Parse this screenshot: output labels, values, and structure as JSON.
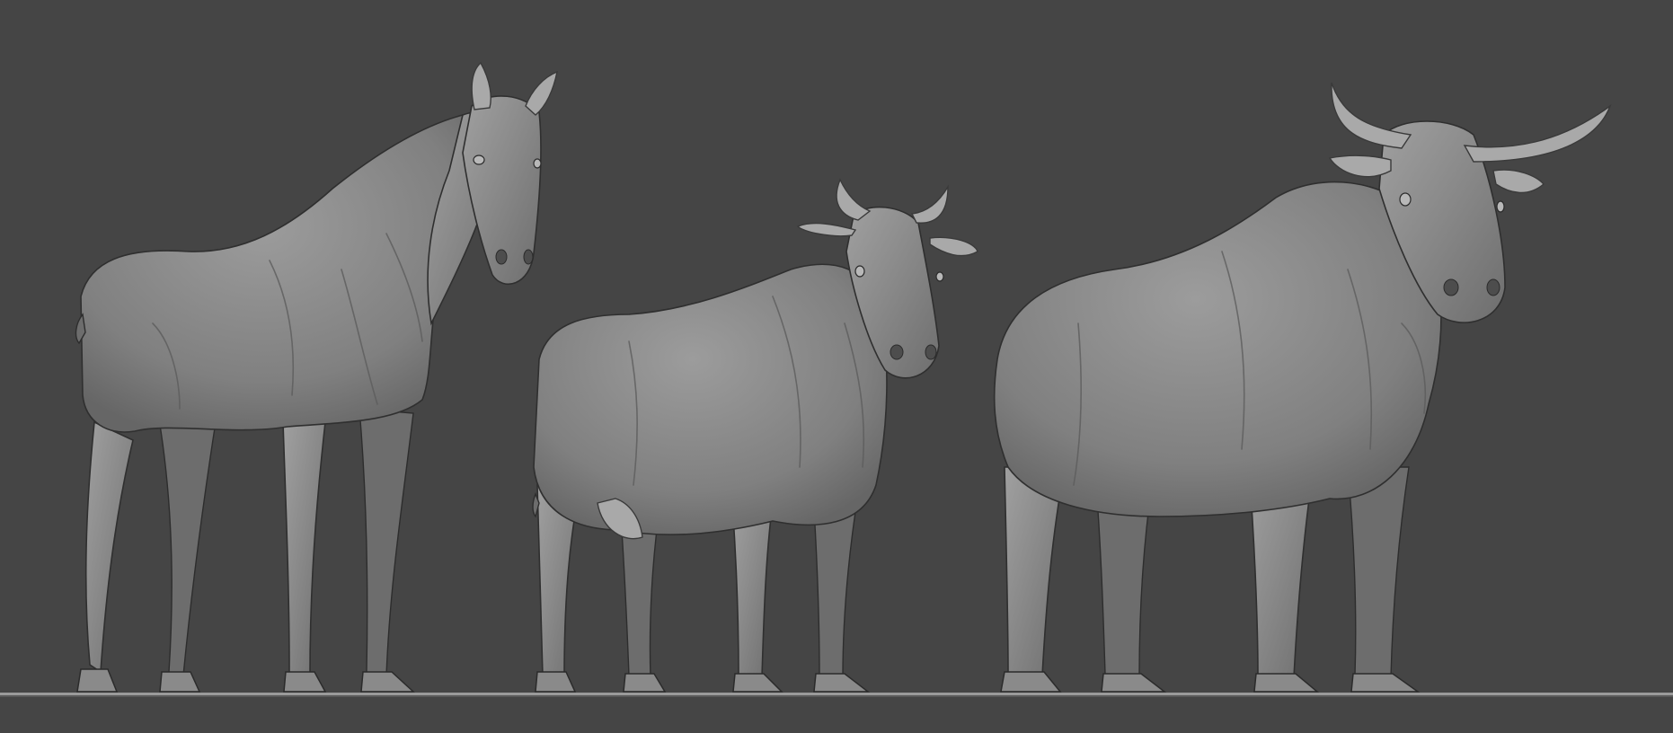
{
  "scene": {
    "background_color": "#454545",
    "model_color": "#8c8c8c",
    "ground_line_color": "#a8a8a8",
    "models": [
      {
        "name": "horse"
      },
      {
        "name": "cow"
      },
      {
        "name": "bull"
      }
    ]
  }
}
